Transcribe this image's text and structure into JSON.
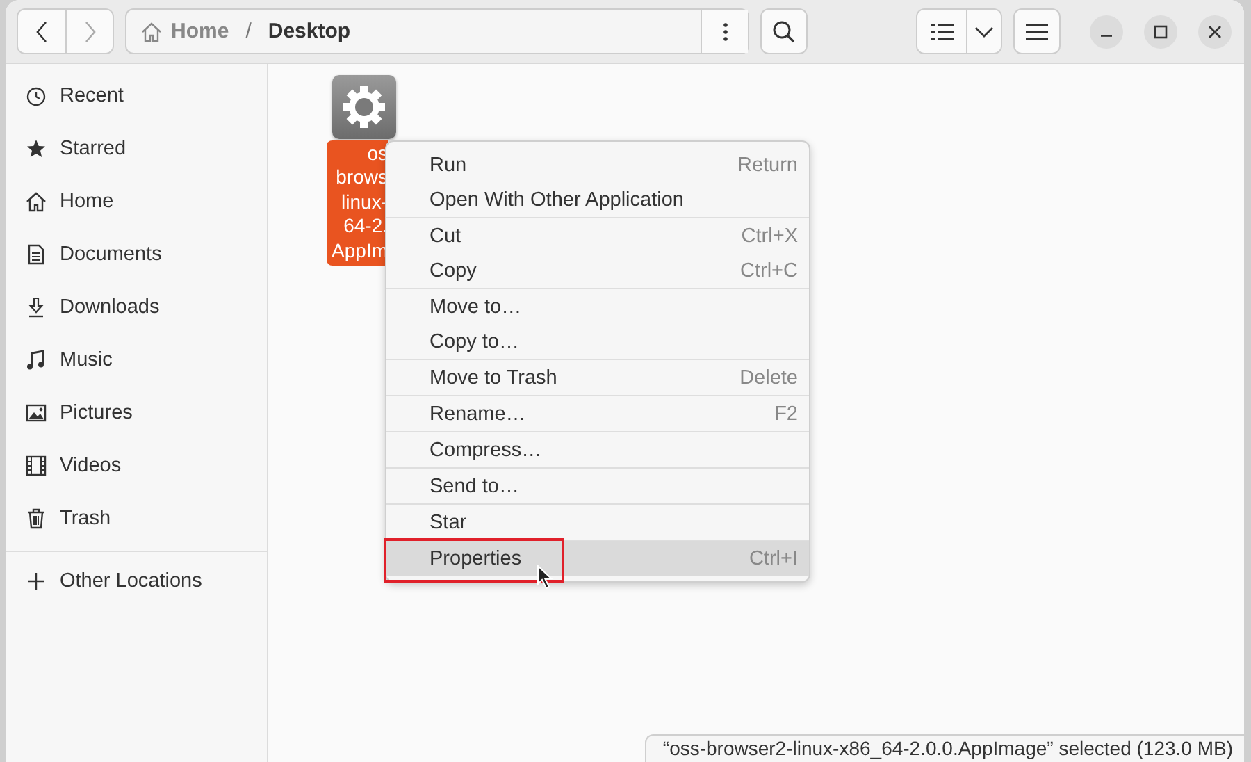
{
  "header": {
    "separator": "/",
    "path": [
      {
        "label": "Home",
        "current": false
      },
      {
        "label": "Desktop",
        "current": true
      }
    ]
  },
  "sidebar": {
    "items": [
      {
        "label": "Recent",
        "kind": "recent"
      },
      {
        "label": "Starred",
        "kind": "star"
      },
      {
        "label": "Home",
        "kind": "home"
      },
      {
        "label": "Documents",
        "kind": "document"
      },
      {
        "label": "Downloads",
        "kind": "download"
      },
      {
        "label": "Music",
        "kind": "music"
      },
      {
        "label": "Pictures",
        "kind": "picture"
      },
      {
        "label": "Videos",
        "kind": "video"
      },
      {
        "label": "Trash",
        "kind": "trash"
      }
    ],
    "other": {
      "label": "Other Locations"
    }
  },
  "file": {
    "label_lines": [
      "os",
      "brows",
      "linux-",
      "64-2.",
      "AppIm"
    ],
    "selected": true
  },
  "context_menu": {
    "groups": [
      [
        {
          "label": "Run",
          "shortcut": "Return",
          "selected": false
        },
        {
          "label": "Open With Other Application",
          "selected": false
        }
      ],
      [
        {
          "label": "Cut",
          "shortcut": "Ctrl+X",
          "selected": false
        },
        {
          "label": "Copy",
          "shortcut": "Ctrl+C",
          "selected": false
        }
      ],
      [
        {
          "label": "Move to…",
          "selected": false
        },
        {
          "label": "Copy to…",
          "selected": false
        }
      ],
      [
        {
          "label": "Move to Trash",
          "shortcut": "Delete",
          "selected": false
        }
      ],
      [
        {
          "label": "Rename…",
          "shortcut": "F2",
          "selected": false
        }
      ],
      [
        {
          "label": "Compress…",
          "selected": false
        }
      ],
      [
        {
          "label": "Send to…",
          "selected": false
        }
      ],
      [
        {
          "label": "Star",
          "selected": false
        }
      ],
      [
        {
          "label": "Properties",
          "shortcut": "Ctrl+I",
          "selected": true
        }
      ]
    ]
  },
  "status_bar": {
    "text": "“oss-browser2-linux-x86_64-2.0.0.AppImage” selected  (123.0 MB)"
  }
}
